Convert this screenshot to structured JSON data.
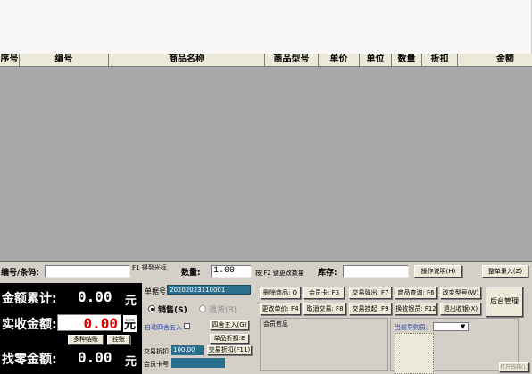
{
  "columns": [
    "序号",
    "编号",
    "商品名称",
    "商品型号",
    "单价",
    "单位",
    "数量",
    "折扣",
    "金额"
  ],
  "input_bar": {
    "code_label": "编号/条码:",
    "code_value": "",
    "f1_hint": "F1 得到光标",
    "qty_label": "数量:",
    "qty_value": "1.00",
    "f2_hint": "按 F2 键更改数量",
    "stock_label": "库存:",
    "stock_value": "",
    "manual_button": "操作说明(H)",
    "batch_entry_button": "整单录入(Z)"
  },
  "summary": {
    "total_label": "金额累计:",
    "total_value": "0.00",
    "total_unit": "元",
    "received_label": "实收金额:",
    "received_value": "0.00",
    "received_unit": "元",
    "multi_settle_button": "多种结账",
    "hang_button": "挂账",
    "change_label": "找零金额:",
    "change_value": "0.00",
    "change_unit": "元"
  },
  "mid": {
    "receipt_label": "单据号",
    "receipt_value": "20202023110001",
    "sale_label": "销售(S)",
    "return_label": "退货(B)",
    "auto_round_label": "自动四舍五入",
    "round_button": "四舍五入(G)",
    "item_discount_button": "单品折扣:E",
    "trade_discount_label": "交易折扣",
    "trade_discount_value": "100.00",
    "trade_discount_button": "交易折扣(F11)",
    "member_card_label": "会员卡号",
    "member_card_value": ""
  },
  "actions": {
    "delete_item": "删除商品: Q",
    "member_card": "会员卡: F3",
    "trade_popup": "交易弹出: F7",
    "product_query": "商品查询: F6",
    "change_model": "改变型号(W)",
    "backend_manage": "后台管理",
    "change_price": "更改单价: F4",
    "cancel_trade": "取消交易: F8",
    "trade_hang": "交易挂起: F9",
    "switch_cashier": "换收银员: F12",
    "exit_cashier": "退出收银(X)"
  },
  "member_info_label": "会员信息",
  "current_guide_label": "当前导购员:",
  "guide_value": "",
  "open_drawer_button": "打开钱箱(L)"
}
